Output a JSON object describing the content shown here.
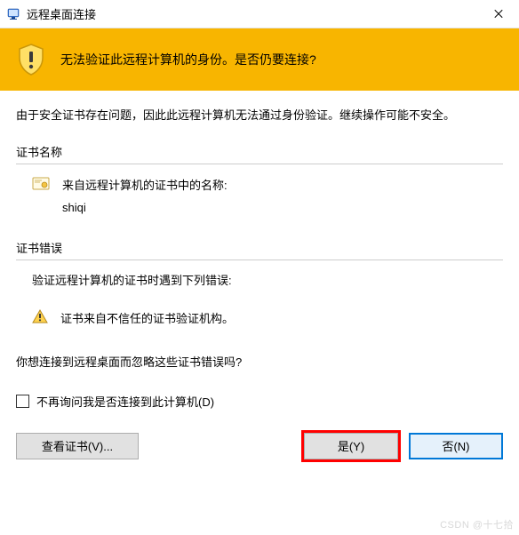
{
  "titlebar": {
    "title": "远程桌面连接"
  },
  "banner": {
    "message": "无法验证此远程计算机的身份。是否仍要连接?"
  },
  "body": {
    "description": "由于安全证书存在问题，因此此远程计算机无法通过身份验证。继续操作可能不安全。"
  },
  "cert_name": {
    "section_title": "证书名称",
    "label": "来自远程计算机的证书中的名称:",
    "value": "shiqi"
  },
  "cert_errors": {
    "section_title": "证书错误",
    "intro": "验证远程计算机的证书时遇到下列错误:",
    "error1": "证书来自不信任的证书验证机构。"
  },
  "question": "你想连接到远程桌面而忽略这些证书错误吗?",
  "checkbox": {
    "label": "不再询问我是否连接到此计算机(D)"
  },
  "buttons": {
    "view_cert": "查看证书(V)...",
    "yes": "是(Y)",
    "no": "否(N)"
  },
  "watermark": "CSDN @十七拾"
}
